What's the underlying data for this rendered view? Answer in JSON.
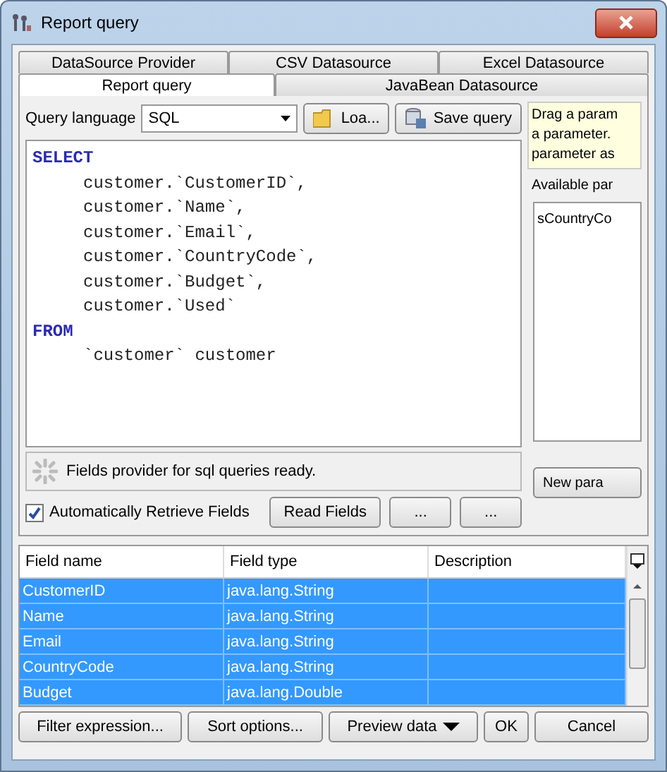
{
  "window": {
    "title": "Report query"
  },
  "tab_rows": [
    [
      {
        "label": "DataSource Provider",
        "selected": false
      },
      {
        "label": "CSV Datasource",
        "selected": false
      },
      {
        "label": "Excel Datasource",
        "selected": false
      }
    ],
    [
      {
        "label": "Report query",
        "selected": true
      },
      {
        "label": "JavaBean Datasource",
        "selected": false
      }
    ]
  ],
  "query_language": {
    "label": "Query language",
    "value": "SQL"
  },
  "load_button": "Loa...",
  "save_button": "Save query",
  "editor": {
    "lines": [
      {
        "text": "SELECT",
        "kind": "keyword"
      },
      {
        "text": "customer.`CustomerID`,",
        "kind": "code"
      },
      {
        "text": "customer.`Name`,",
        "kind": "code"
      },
      {
        "text": "customer.`Email`,",
        "kind": "code"
      },
      {
        "text": "customer.`CountryCode`,",
        "kind": "code"
      },
      {
        "text": "customer.`Budget`,",
        "kind": "code"
      },
      {
        "text": "customer.`Used`",
        "kind": "code"
      },
      {
        "text": "FROM",
        "kind": "keyword"
      },
      {
        "text": "`customer` customer",
        "kind": "code"
      }
    ]
  },
  "parameters": {
    "hint_lines": [
      "Drag a param",
      "a parameter.",
      "parameter as"
    ],
    "label": "Available par",
    "items": [
      "sCountryCo"
    ],
    "new_button": "New para"
  },
  "status": "Fields provider for sql queries ready.",
  "auto_retrieve": {
    "label": "Automatically Retrieve Fields",
    "checked": true
  },
  "read_fields_button": "Read Fields",
  "more_buttons": [
    "...",
    "..."
  ],
  "table": {
    "columns": [
      "Field name",
      "Field type",
      "Description"
    ],
    "rows": [
      {
        "name": "CustomerID",
        "type": "java.lang.String",
        "selected": true
      },
      {
        "name": "Name",
        "type": "java.lang.String",
        "selected": true
      },
      {
        "name": "Email",
        "type": "java.lang.String",
        "selected": true
      },
      {
        "name": "CountryCode",
        "type": "java.lang.String",
        "selected": true
      },
      {
        "name": "Budget",
        "type": "java.lang.Double",
        "selected": true
      }
    ]
  },
  "buttons": {
    "filter": "Filter expression...",
    "sort": "Sort options...",
    "preview": "Preview data",
    "ok": "OK",
    "cancel": "Cancel"
  }
}
